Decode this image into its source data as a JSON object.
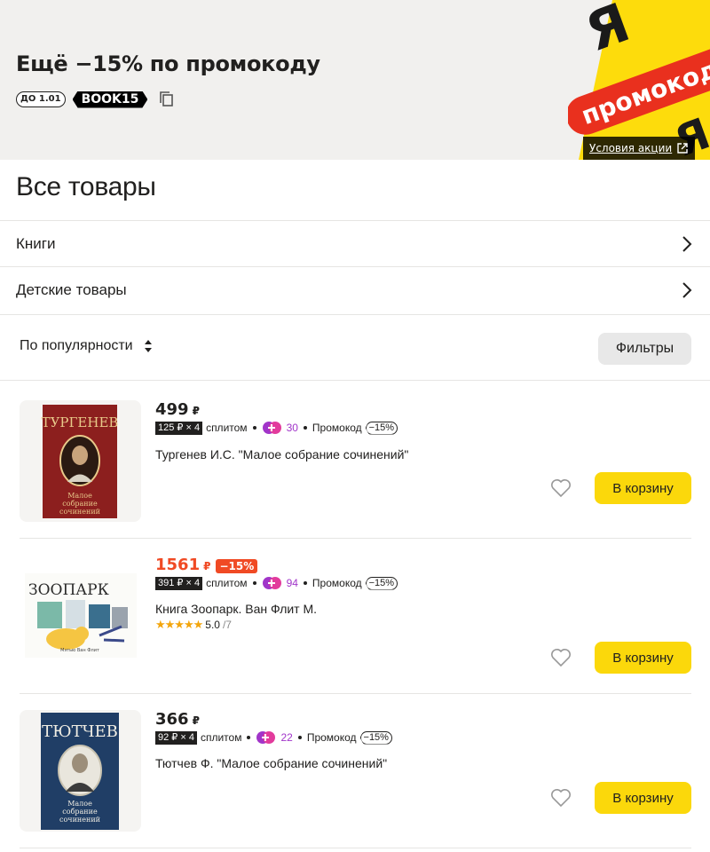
{
  "promo": {
    "title": "Ещё −15% по промокоду",
    "date_tag": "ДО 1.01",
    "code": "BOOK15",
    "art_text": "промокод",
    "terms_label": "Условия акции",
    "colors": {
      "banner_bg": "#f1f0ee",
      "art_yellow": "#fddc0c",
      "art_red": "#e9301e"
    }
  },
  "all_goods": {
    "title": "Все товары",
    "categories": [
      {
        "label": "Книги"
      },
      {
        "label": "Детские товары"
      }
    ]
  },
  "toolbar": {
    "sort_label": "По популярности",
    "filters_label": "Фильтры"
  },
  "products": [
    {
      "price": "499",
      "currency": "₽",
      "on_sale": false,
      "discount": "",
      "split_box": "125 ₽ × 4",
      "split_label": "сплитом",
      "plus_points": "30",
      "promo_label": "Промокод",
      "promo_badge": "−15%",
      "name": "Тургенев И.С. \"Малое собрание сочинений\"",
      "cover": {
        "author": "ТУРГЕНЕВ",
        "subtitle": "Малое собрание сочинений",
        "bg": "#8c1f1e"
      },
      "cart_label": "В корзину"
    },
    {
      "price": "1561",
      "currency": "₽",
      "on_sale": true,
      "discount": "−15%",
      "split_box": "391 ₽ × 4",
      "split_label": "сплитом",
      "plus_points": "94",
      "promo_label": "Промокод",
      "promo_badge": "−15%",
      "name": "Книга Зоопарк. Ван Флит М.",
      "rating_stars": 5,
      "rating_value": "5.0",
      "rating_count": "/7",
      "cover": {
        "title": "ЗООПАРК",
        "author_small": "Мэтью Ван Флит"
      },
      "cart_label": "В корзину"
    },
    {
      "price": "366",
      "currency": "₽",
      "on_sale": false,
      "discount": "",
      "split_box": "92 ₽ × 4",
      "split_label": "сплитом",
      "plus_points": "22",
      "promo_label": "Промокод",
      "promo_badge": "−15%",
      "name": "Тютчев Ф. \"Малое собрание сочинений\"",
      "cover": {
        "author": "ТЮТЧЕВ",
        "subtitle": "Малое собрание сочинений",
        "bg": "#203e66"
      },
      "cart_label": "В корзину"
    }
  ],
  "icons": [
    "copy-icon",
    "external-link-icon",
    "chevron-right-icon",
    "sort-icon",
    "plus-points-icon",
    "heart-icon",
    "star-icon"
  ]
}
